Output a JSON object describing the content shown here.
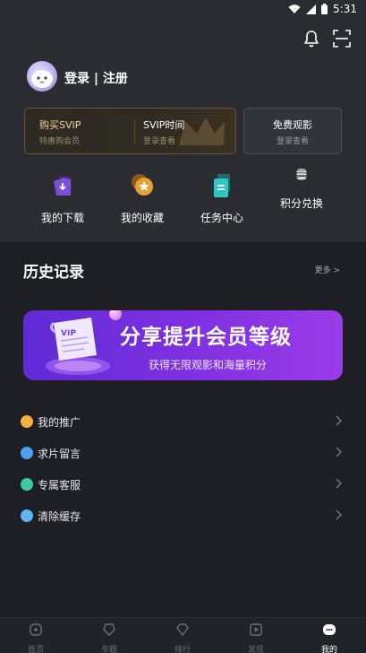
{
  "status_bar": {
    "time": "5:31"
  },
  "user": {
    "login_label": "登录 | 注册"
  },
  "vip": {
    "buy_title": "购买SVIP",
    "buy_sub": "特惠购会员",
    "time_title": "SVIP时间",
    "time_sub": "登录查看"
  },
  "free": {
    "title": "免费观影",
    "sub": "登录查看"
  },
  "shortcuts": [
    {
      "label": "我的下载",
      "icon": "download-icon"
    },
    {
      "label": "我的收藏",
      "icon": "favorite-icon"
    },
    {
      "label": "任务中心",
      "icon": "task-icon"
    },
    {
      "label": "积分兑换",
      "icon": "points-icon"
    }
  ],
  "history": {
    "title": "历史记录",
    "more": "更多 >"
  },
  "banner": {
    "title": "分享提升会员等级",
    "subtitle": "获得无限观影和海量积分",
    "badge": "VIP"
  },
  "menu": [
    {
      "label": "我的推广",
      "color": "#f0b23c"
    },
    {
      "label": "求片留言",
      "color": "#4aa3f0"
    },
    {
      "label": "专属客服",
      "color": "#3cc9a8"
    },
    {
      "label": "清除缓存",
      "color": "#5fb6f0"
    }
  ],
  "tabs": [
    {
      "label": "首页",
      "icon": "home-icon"
    },
    {
      "label": "专题",
      "icon": "topic-icon"
    },
    {
      "label": "排行",
      "icon": "rank-icon"
    },
    {
      "label": "发现",
      "icon": "discover-icon"
    },
    {
      "label": "我的",
      "icon": "profile-icon",
      "active": true
    }
  ],
  "colors": {
    "background": "#1e1f24",
    "header": "#2b2c31",
    "vip_gold": "#f3d6a4",
    "accent_purple": "#7a2fe0"
  }
}
